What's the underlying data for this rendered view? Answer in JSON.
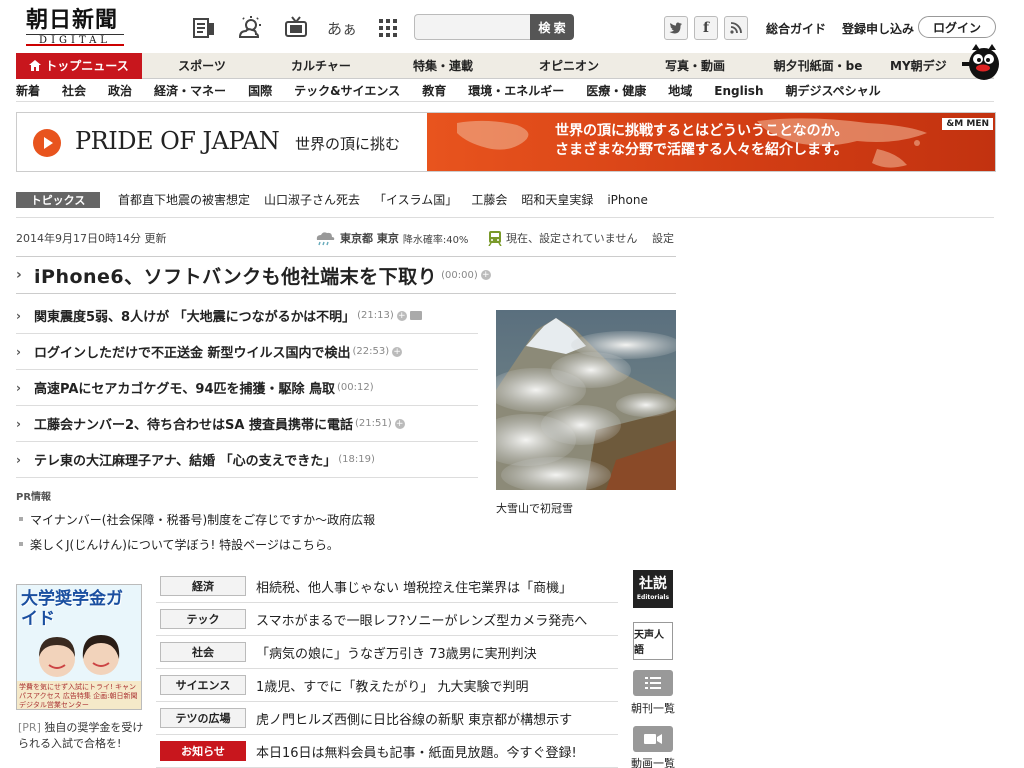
{
  "header": {
    "logo_kanji": "朝日新聞",
    "logo_digital": "DIGITAL",
    "search_button": "検 索",
    "search_placeholder": "",
    "links": [
      "総合ガイド",
      "登録申し込み"
    ],
    "login": "ログイン",
    "icons": [
      "news-reader-icon",
      "weather-icon",
      "tv-icon",
      "font-size-icon",
      "grid-menu-icon"
    ],
    "font_icon_text": "あぁ",
    "social": [
      "twitter-icon",
      "facebook-icon",
      "rss-icon"
    ]
  },
  "mainnav": [
    {
      "label": "トップニュース",
      "active": true
    },
    {
      "label": "スポーツ"
    },
    {
      "label": "カルチャー"
    },
    {
      "label": "特集・連載"
    },
    {
      "label": "オピニオン"
    },
    {
      "label": "写真・動画"
    },
    {
      "label": "朝夕刊紙面・be"
    },
    {
      "label": "MY朝デジ"
    }
  ],
  "subnav": [
    "新着",
    "社会",
    "政治",
    "経済・マネー",
    "国際",
    "テック&サイエンス",
    "教育",
    "環境・エネルギー",
    "医療・健康",
    "地域",
    "English",
    "朝デジスペシャル"
  ],
  "banner": {
    "title": "PRIDE OF JAPAN",
    "subtitle": "世界の頂に挑む",
    "text_line1": "世界の頂に挑戦するとはどういうことなのか。",
    "text_line2": "さまざまな分野で活躍する人々を紹介します。",
    "badge": "&M MEN"
  },
  "topics": {
    "label": "トピックス",
    "items": [
      "首都直下地震の被害想定",
      "山口淑子さん死去",
      "「イスラム国」",
      "工藤会",
      "昭和天皇実録",
      "iPhone"
    ]
  },
  "dateline": {
    "date": "2014年9月17日0時14分 更新",
    "weather_place": "東京都 東京",
    "rain_chance": "降水確率:40%",
    "train": "現在、設定されていません",
    "settings": "設定"
  },
  "headline": {
    "text": "iPhone6、ソフトバンクも他社端末を下取り",
    "time": "(00:00)"
  },
  "news": [
    {
      "text": "関東震度5弱、8人けが 「大地震につながるかは不明」",
      "time": "(21:13)",
      "video": true
    },
    {
      "text": "ログインしただけで不正送金 新型ウイルス国内で検出",
      "time": "(22:53)"
    },
    {
      "text": "高速PAにセアカゴケグモ、94匹を捕獲・駆除 鳥取",
      "time": "(00:12)"
    },
    {
      "text": "工藤会ナンバー2、待ち合わせはSA 捜査員携帯に電話",
      "time": "(21:51)"
    },
    {
      "text": "テレ東の大江麻理子アナ、結婚 「心の支えできた」",
      "time": "(18:19)"
    }
  ],
  "photo_caption": "大雪山で初冠雪",
  "pr": {
    "label": "PR情報",
    "items": [
      "マイナンバー(社会保障・税番号)制度をご存じですか〜政府広報",
      "楽しくJ(じんけん)について学ぼう! 特設ページはこちら。"
    ]
  },
  "ad": {
    "title": "大学奨学金ガイド",
    "footer": "学費を気にせず入試にトライ! キャンパスアクセス 広告特集 企画:朝日新聞デジタル営業センター",
    "caption_pr": "[PR]",
    "caption": "独自の奨学金を受けられる入試で合格を!"
  },
  "categories": [
    {
      "tag": "経済",
      "text": "相続税、他人事じゃない 増税控え住宅業界は「商機」"
    },
    {
      "tag": "テック",
      "text": "スマホがまるで一眼レフ?ソニーがレンズ型カメラ発売へ"
    },
    {
      "tag": "社会",
      "text": "「病気の娘に」うなぎ万引き 73歳男に実刑判決"
    },
    {
      "tag": "サイエンス",
      "text": "1歳児、すでに「教えたがり」 九大実験で判明"
    },
    {
      "tag": "テツの広場",
      "text": "虎ノ門ヒルズ西側に日比谷線の新駅 東京都が構想示す"
    },
    {
      "tag": "お知らせ",
      "text": "本日16日は無料会員も記事・紙面見放題。今すぐ登録!",
      "red": true
    }
  ],
  "rightcol": {
    "shasetsu": "社説",
    "shasetsu_sub": "Editorials",
    "tensei": "天声人語",
    "choukan": "朝刊一覧",
    "douga": "動画一覧"
  },
  "colors": {
    "accent_red": "#c8161d",
    "banner_orange": "#e8541e",
    "nav_bg": "#efece4"
  }
}
